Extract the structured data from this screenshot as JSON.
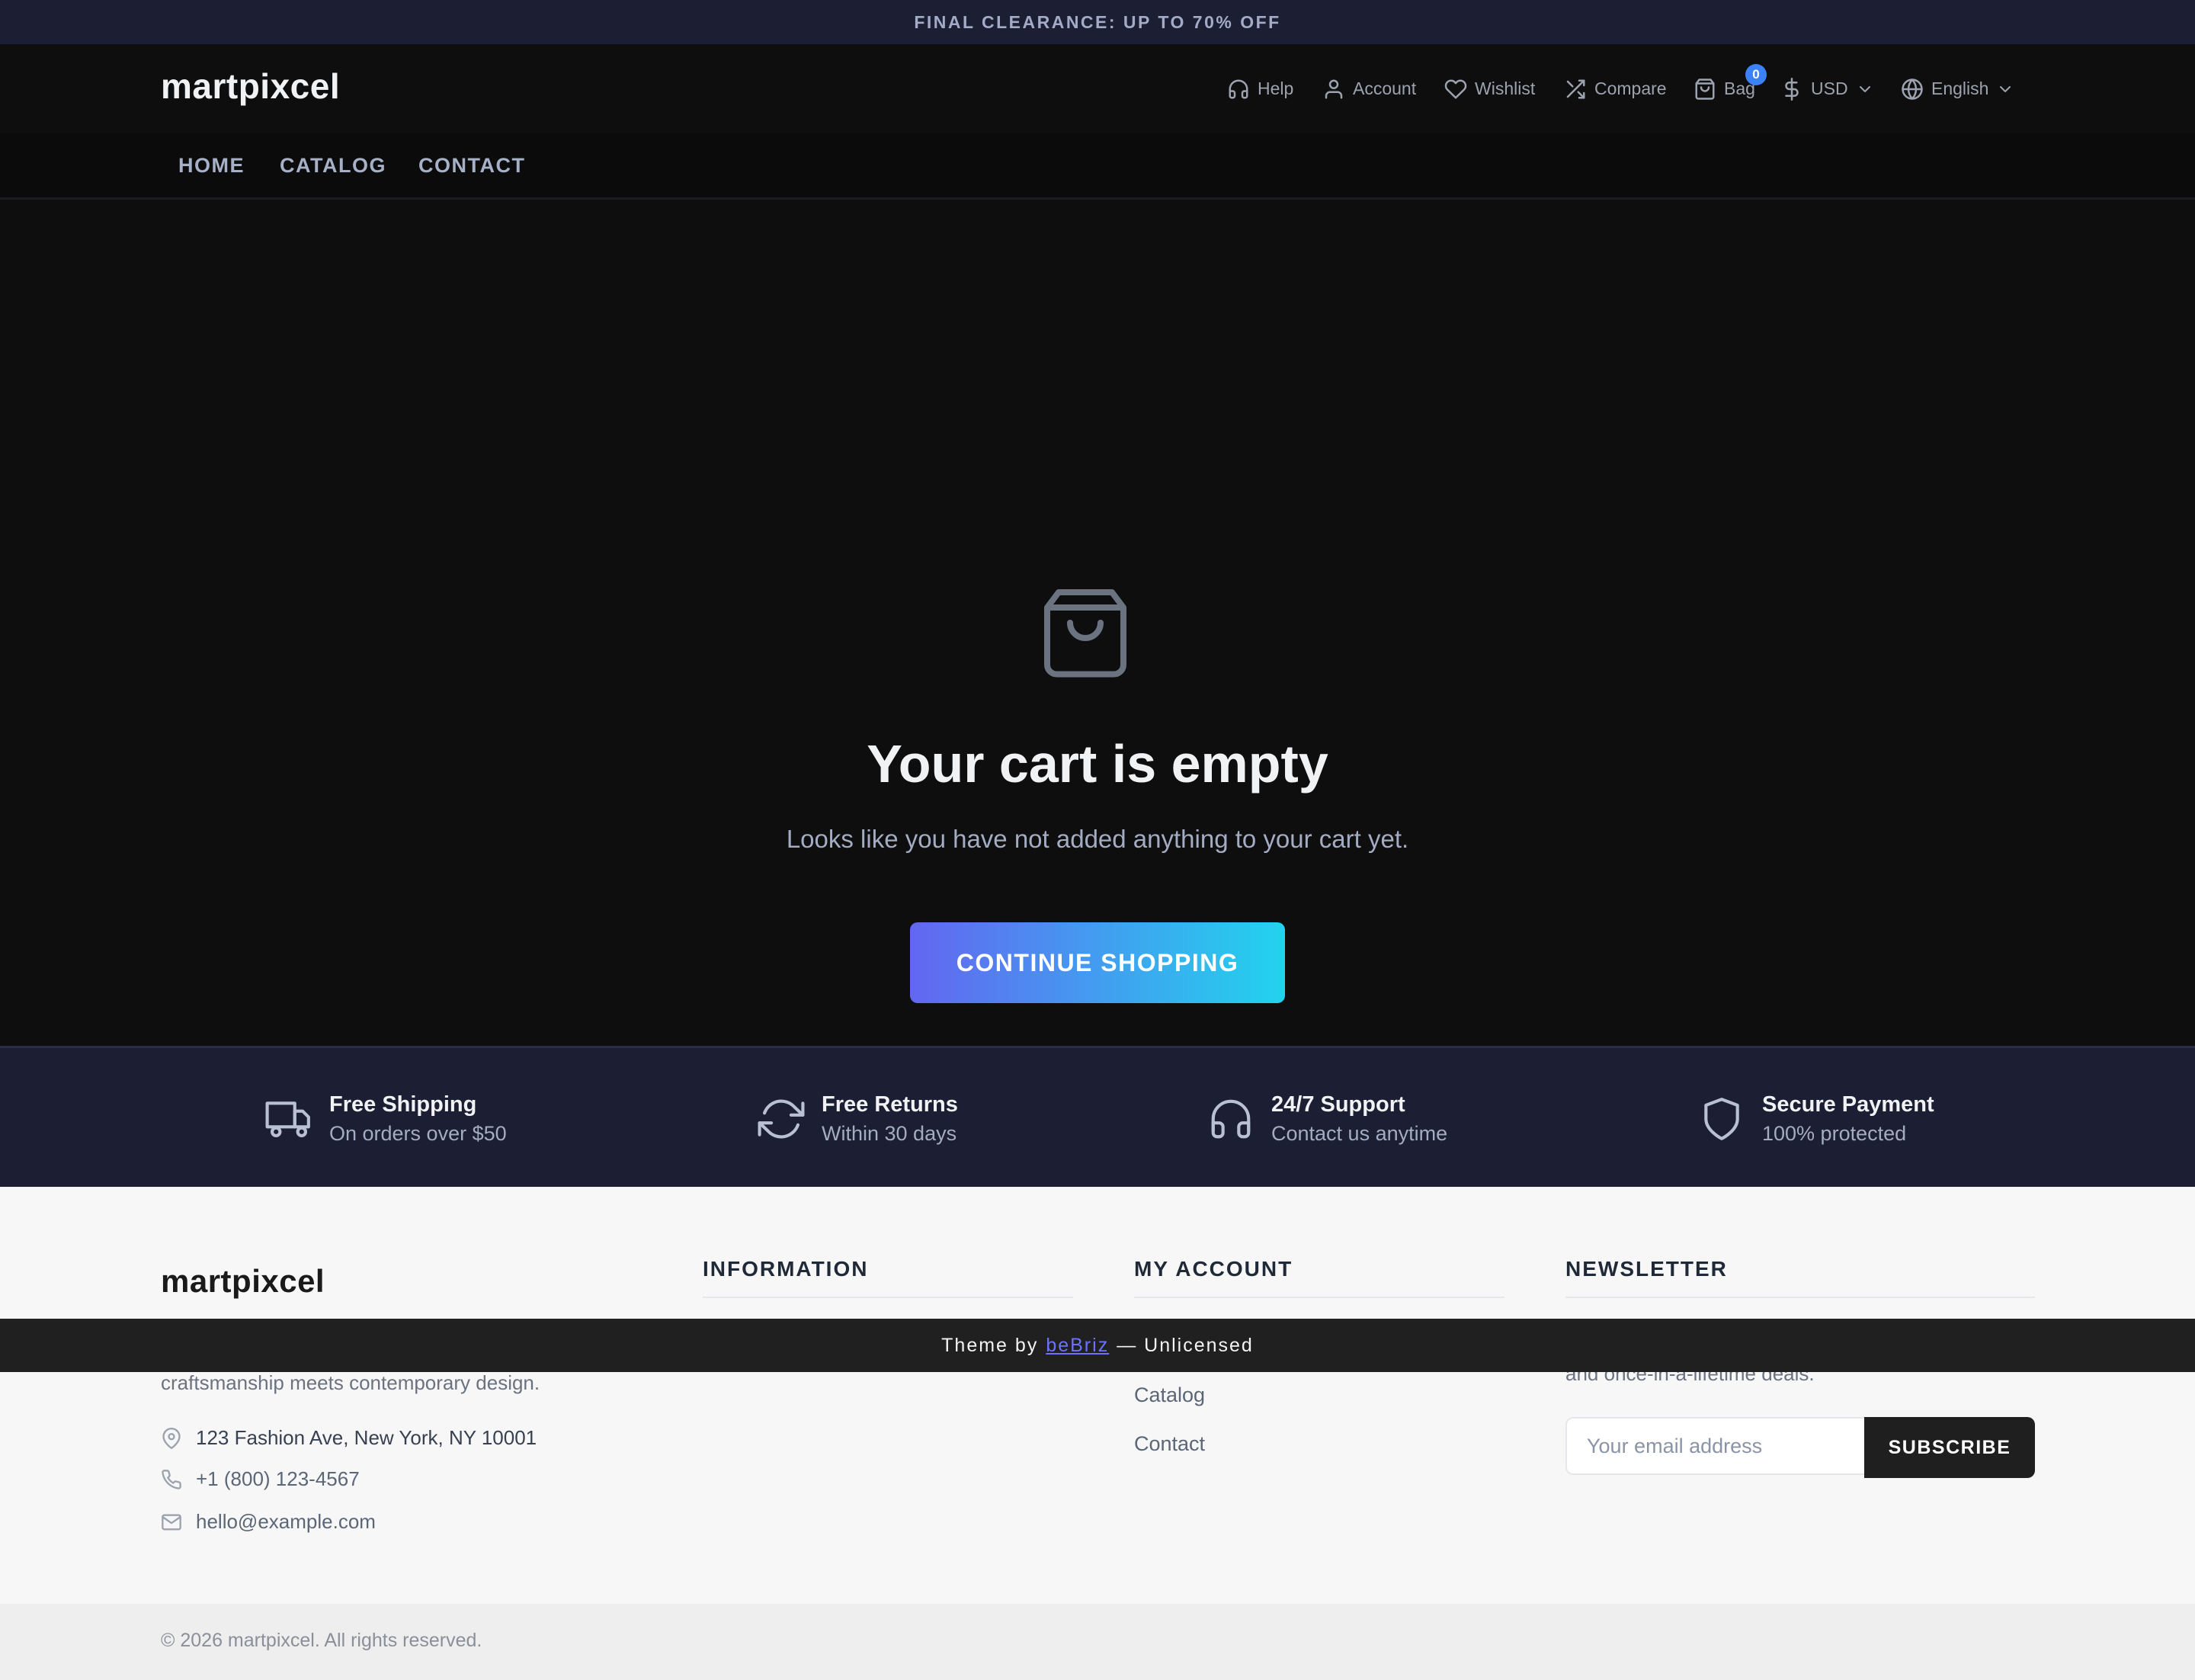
{
  "announcement": "FINAL CLEARANCE: UP TO 70% OFF",
  "header": {
    "logo": "martpixcel",
    "help": "Help",
    "account": "Account",
    "wishlist": "Wishlist",
    "compare": "Compare",
    "bag": "Bag",
    "bag_count": "0",
    "currency": "USD",
    "language": "English"
  },
  "nav": {
    "home": "HOME",
    "catalog": "CATALOG",
    "contact": "CONTACT"
  },
  "cart": {
    "title": "Your cart is empty",
    "subtitle": "Looks like you have not added anything to your cart yet.",
    "cta": "CONTINUE SHOPPING"
  },
  "features": [
    {
      "title": "Free Shipping",
      "sub": "On orders over $50"
    },
    {
      "title": "Free Returns",
      "sub": "Within 30 days"
    },
    {
      "title": "24/7 Support",
      "sub": "Contact us anytime"
    },
    {
      "title": "Secure Payment",
      "sub": "100% protected"
    }
  ],
  "footer": {
    "logo": "martpixcel",
    "description": "craftsmanship meets contemporary design.",
    "address": "123 Fashion Ave, New York, NY 10001",
    "phone": "+1 (800) 123-4567",
    "email": "hello@example.com",
    "info_heading": "INFORMATION",
    "account_heading": "MY ACCOUNT",
    "account_links": [
      "Catalog",
      "Contact"
    ],
    "newsletter_heading": "NEWSLETTER",
    "newsletter_text": "and once-in-a-lifetime deals.",
    "email_placeholder": "Your email address",
    "subscribe": "SUBSCRIBE"
  },
  "theme_bar": {
    "prefix": "Theme by",
    "link": "beBriz",
    "suffix": "— Unlicensed"
  },
  "copyright": "© 2026 martpixcel. All rights reserved.",
  "colors": {
    "accent_start": "#6366f1",
    "accent_end": "#22d3ee",
    "badge": "#3b82f6",
    "link": "#6d73ff"
  }
}
